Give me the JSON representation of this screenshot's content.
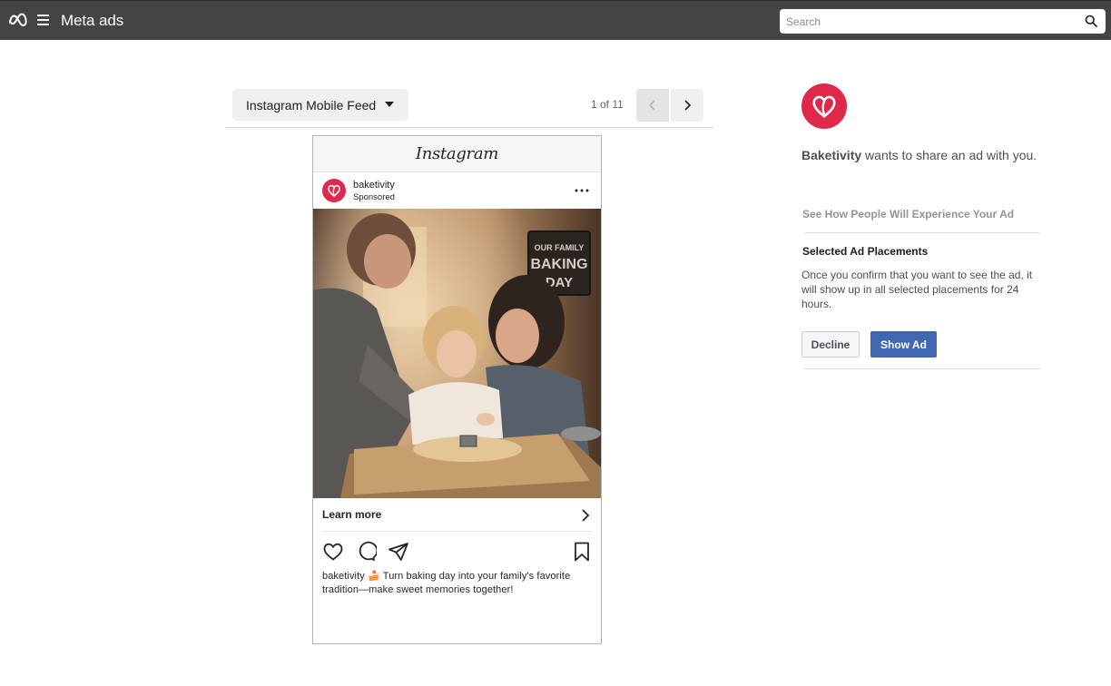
{
  "colors": {
    "topbar": "#444444",
    "brand_red": "#e0284a",
    "primary_button": "#4267b2"
  },
  "header": {
    "brand": "Meta ads",
    "logo_icon": "meta-infinity-icon",
    "menu_icon": "hamburger-icon",
    "search": {
      "placeholder": "Search",
      "value": "",
      "icon": "search-icon"
    }
  },
  "preview": {
    "placement_label": "Instagram Mobile Feed",
    "page_count": "1 of 11",
    "prev_icon": "chevron-left-icon",
    "next_icon": "chevron-right-icon"
  },
  "post": {
    "platform_wordmark": "Instagram",
    "account_name": "baketivity",
    "sponsored_label": "Sponsored",
    "image_sign_text": [
      "OUR FAMILY",
      "BAKING",
      "DAY"
    ],
    "cta_label": "Learn more",
    "caption_account": "baketivity",
    "caption_emoji": "🍰",
    "caption_text": "Turn baking day into your family's favorite tradition—make sweet memories together!",
    "action_icons": [
      "heart-icon",
      "comment-icon",
      "share-icon",
      "bookmark-icon"
    ]
  },
  "panel": {
    "advertiser": "Baketivity",
    "share_text": "wants to share an ad with you.",
    "experience_link": "See How People Will Experience Your Ad",
    "placements_heading": "Selected Ad Placements",
    "placements_body": "Once you confirm that you want to see the ad, it will show up in all selected placements for 24 hours.",
    "decline_label": "Decline",
    "show_label": "Show Ad"
  }
}
